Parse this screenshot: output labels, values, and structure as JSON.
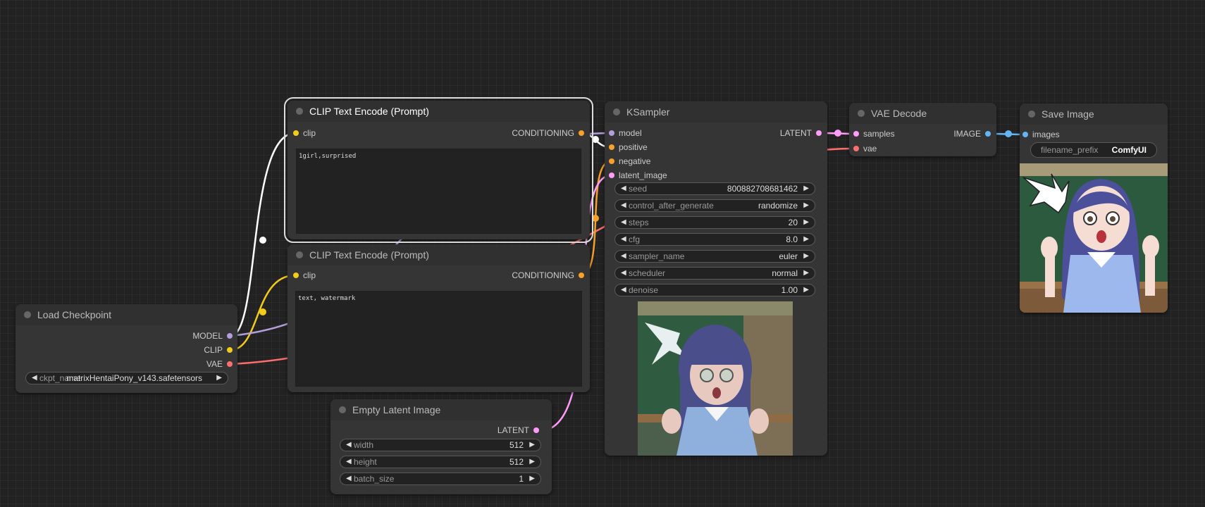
{
  "nodes": {
    "load_checkpoint": {
      "title": "Load Checkpoint",
      "outputs": [
        "MODEL",
        "CLIP",
        "VAE"
      ],
      "ckpt_label": "ckpt_name",
      "ckpt_value": "matrixHentaiPony_v143.safetensors"
    },
    "clip_pos": {
      "title": "CLIP Text Encode (Prompt)",
      "input": "clip",
      "output": "CONDITIONING",
      "text": "1girl,surprised"
    },
    "clip_neg": {
      "title": "CLIP Text Encode (Prompt)",
      "input": "clip",
      "output": "CONDITIONING",
      "text": "text, watermark"
    },
    "empty_latent": {
      "title": "Empty Latent Image",
      "output": "LATENT",
      "widgets": [
        {
          "label": "width",
          "value": "512"
        },
        {
          "label": "height",
          "value": "512"
        },
        {
          "label": "batch_size",
          "value": "1"
        }
      ]
    },
    "ksampler": {
      "title": "KSampler",
      "inputs": [
        "model",
        "positive",
        "negative",
        "latent_image"
      ],
      "output": "LATENT",
      "widgets": [
        {
          "label": "seed",
          "value": "800882708681462"
        },
        {
          "label": "control_after_generate",
          "value": "randomize"
        },
        {
          "label": "steps",
          "value": "20"
        },
        {
          "label": "cfg",
          "value": "8.0"
        },
        {
          "label": "sampler_name",
          "value": "euler"
        },
        {
          "label": "scheduler",
          "value": "normal"
        },
        {
          "label": "denoise",
          "value": "1.00"
        }
      ]
    },
    "vae_decode": {
      "title": "VAE Decode",
      "inputs": [
        "samples",
        "vae"
      ],
      "output": "IMAGE"
    },
    "save_image": {
      "title": "Save Image",
      "input": "images",
      "prefix_label": "filename_prefix",
      "prefix_value": "ComfyUI"
    }
  },
  "colors": {
    "clip": "#f3cc1a",
    "conditioning": "#f7a12a",
    "model": "#b39ddb",
    "latent": "#ff9cf9",
    "vae": "#ff6e6e",
    "image": "#64b5f6",
    "selected_link": "#ffffff"
  }
}
